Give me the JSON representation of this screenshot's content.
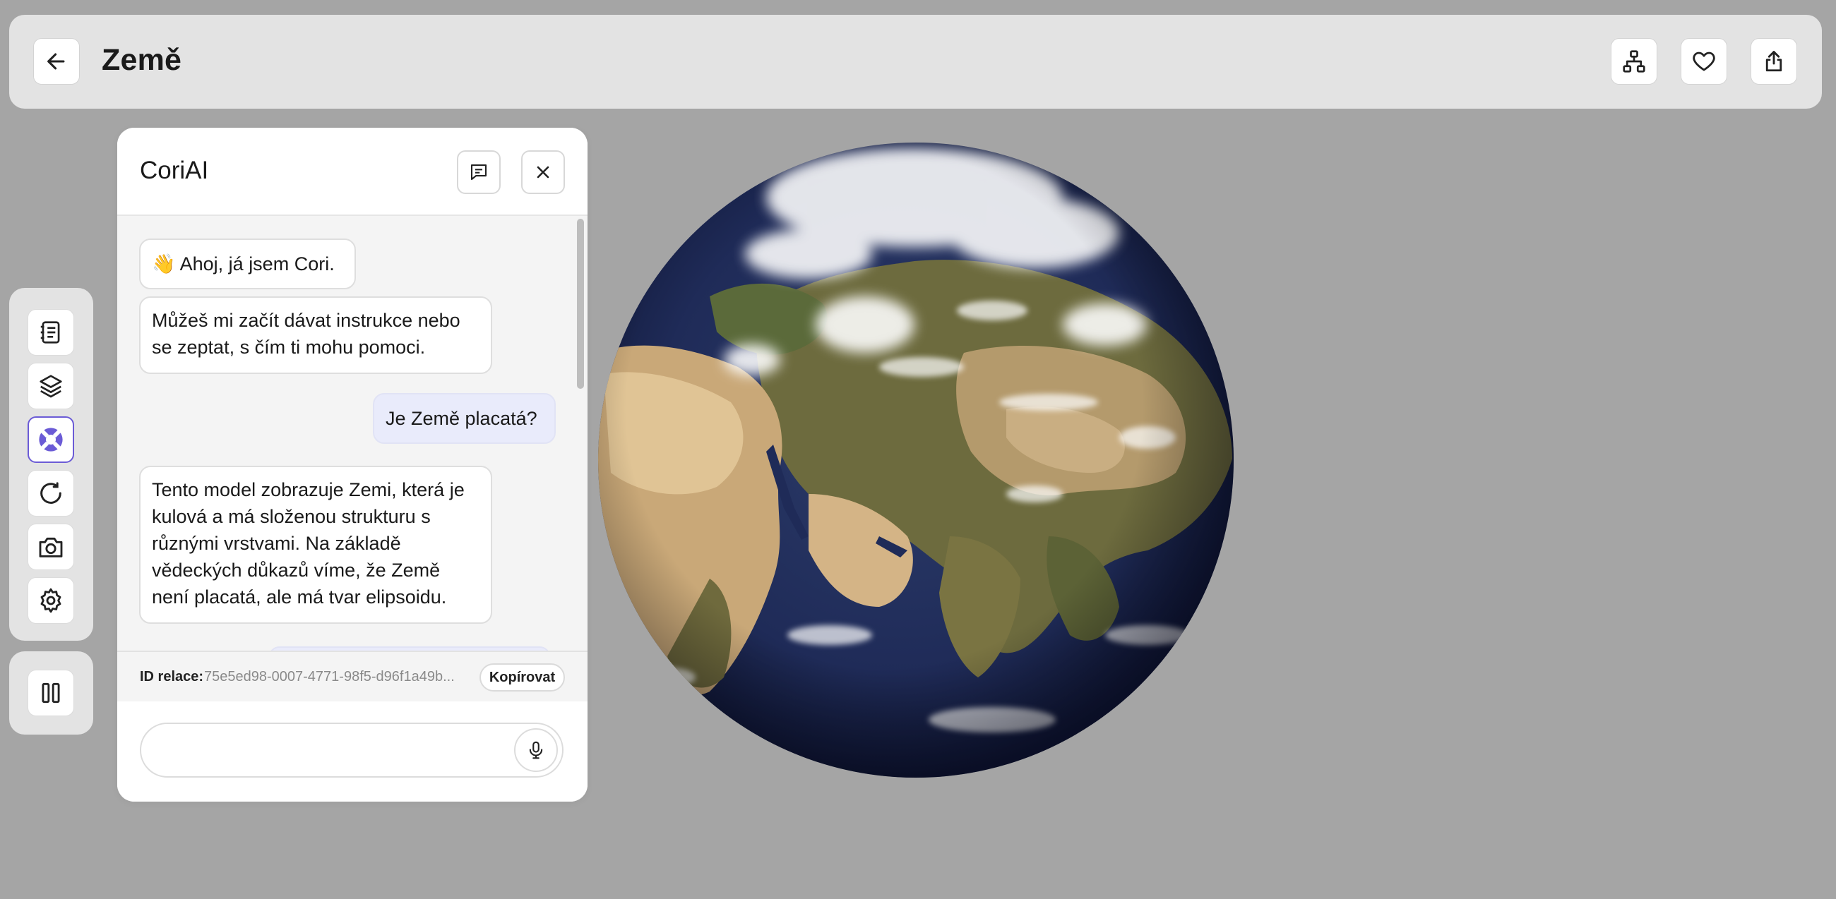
{
  "header": {
    "title": "Země",
    "icons": [
      "arrow-left-icon",
      "hierarchy-icon",
      "heart-icon",
      "share-icon"
    ]
  },
  "sidebar": {
    "tools": [
      "notebook-icon",
      "layers-icon",
      "help-buoy-icon",
      "reset-icon",
      "camera-icon",
      "settings-icon"
    ],
    "active": "help-buoy-icon",
    "bottom": "pause-icon"
  },
  "chat": {
    "title": "CoriAI",
    "messages": [
      {
        "role": "ai",
        "text": "👋 Ahoj, já jsem Cori."
      },
      {
        "role": "ai",
        "text": "Můžeš mi začít dávat instrukce nebo se zeptat, s čím ti mohu pomoci."
      },
      {
        "role": "user",
        "text": "Je Země placatá?"
      },
      {
        "role": "ai",
        "text": "Tento model zobrazuje Zemi, která je kulová a má složenou strukturu s různými vrstvami. Na základě vědeckých důkazů víme, že Země není placatá, ale má tvar elipsoidu."
      }
    ],
    "session_label": "ID relace:",
    "session_id": "75e5ed98-0007-4771-98f5-d96f1a49b...",
    "copy_label": "Kopírovat",
    "input_placeholder": ""
  },
  "colors": {
    "background": "#a5a5a5",
    "bar": "#e3e3e3",
    "accent": "#6b5bd6",
    "user_bubble": "#e9ebfb",
    "ocean": "#1d2a55"
  }
}
